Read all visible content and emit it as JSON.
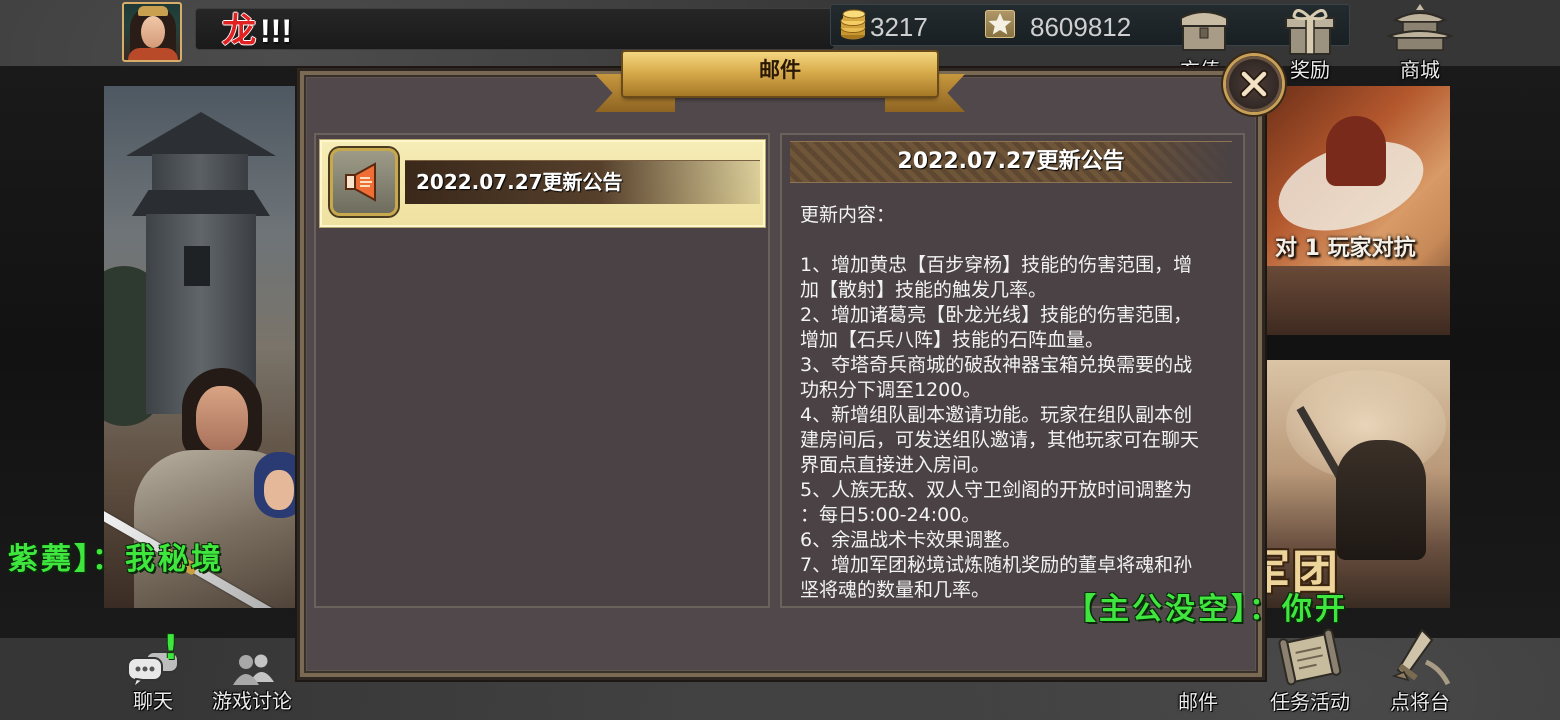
{
  "top_bar": {
    "marquee_highlight": "龙",
    "marquee_suffix": "!!!",
    "gold_amount": "3217",
    "points_amount": "8609812",
    "gold_icon": "gold-coins-icon",
    "points_icon": "star-icon",
    "menu": [
      {
        "label": "充值",
        "icon": "recharge-chest-icon"
      },
      {
        "label": "奖励",
        "icon": "gift-box-icon"
      },
      {
        "label": "商城",
        "icon": "pagoda-shop-icon"
      }
    ]
  },
  "mail_dialog": {
    "title": "邮件",
    "close_icon": "close-icon",
    "list": [
      {
        "title": "2022.07.27更新公告",
        "icon": "megaphone-icon",
        "selected": true
      }
    ],
    "detail": {
      "title": "2022.07.27更新公告",
      "heading": "更新内容：",
      "lines": [
        "1、增加黄忠【百步穿杨】技能的伤害范围，增",
        "加【散射】技能的触发几率。",
        "2、增加诸葛亮【卧龙光线】技能的伤害范围，",
        "增加【石兵八阵】技能的石阵血量。",
        "3、夺塔奇兵商城的破敌神器宝箱兑换需要的战",
        "功积分下调至1200。",
        "4、新增组队副本邀请功能。玩家在组队副本创",
        "建房间后，可发送组队邀请，其他玩家可在聊天",
        "界面点直接进入房间。",
        "5、人族无敌、双人守卫剑阁的开放时间调整为",
        "：每日5:00-24:00。",
        "6、余温战术卡效果调整。",
        "7、增加军团秘境试炼随机奖励的董卓将魂和孙",
        "坚将魂的数量和几率。"
      ]
    }
  },
  "banners": {
    "pvp_label": "对 1 玩家对抗",
    "legion_label": "军团"
  },
  "chat_overlay": [
    {
      "text": "紫蕘】：我秘境"
    },
    {
      "text": "【主公没空】：你开"
    }
  ],
  "bottom_bar": {
    "chat": {
      "label": "聊天",
      "badge": "!",
      "icon": "chat-bubbles-icon"
    },
    "discussion": {
      "label": "游戏讨论",
      "icon": "two-people-icon"
    },
    "mail": {
      "label": "邮件",
      "icon": "envelope-icon"
    },
    "tasks": {
      "label": "任务活动",
      "icon": "scroll-icon"
    },
    "heroes": {
      "label": "点将台",
      "icon": "sword-icon"
    }
  },
  "colors": {
    "marquee_red": "#e22222",
    "chat_green": "#3ee63e",
    "selected_item": "#f3e7aa",
    "ribbon_gold": "#d8ac4c",
    "panel_bg": "#4a4244"
  }
}
